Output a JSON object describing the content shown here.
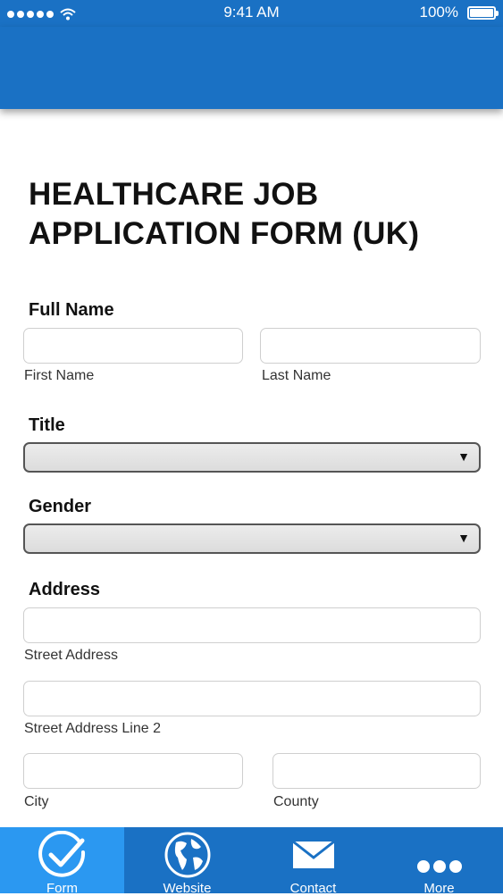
{
  "status_bar": {
    "time": "9:41 AM",
    "battery": "100%"
  },
  "form": {
    "title": "HEALTHCARE JOB APPLICATION FORM (UK)",
    "full_name": {
      "label": "Full Name",
      "first_value": "",
      "first_sublabel": "First Name",
      "last_value": "",
      "last_sublabel": "Last Name"
    },
    "title_field": {
      "label": "Title",
      "selected": ""
    },
    "gender_field": {
      "label": "Gender",
      "selected": ""
    },
    "address": {
      "label": "Address",
      "street_value": "",
      "street_sublabel": "Street Address",
      "street2_value": "",
      "street2_sublabel": "Street Address Line 2",
      "city_value": "",
      "city_sublabel": "City",
      "county_value": "",
      "county_sublabel": "County"
    }
  },
  "tab_bar": {
    "tabs": [
      {
        "label": "Form",
        "icon": "checkmark-circle-icon",
        "active": true
      },
      {
        "label": "Website",
        "icon": "globe-icon",
        "active": false
      },
      {
        "label": "Contact",
        "icon": "envelope-icon",
        "active": false
      },
      {
        "label": "More",
        "icon": "more-dots-icon",
        "active": false
      }
    ]
  },
  "colors": {
    "primary": "#1a71c4",
    "active_tab": "#2b98f1"
  }
}
